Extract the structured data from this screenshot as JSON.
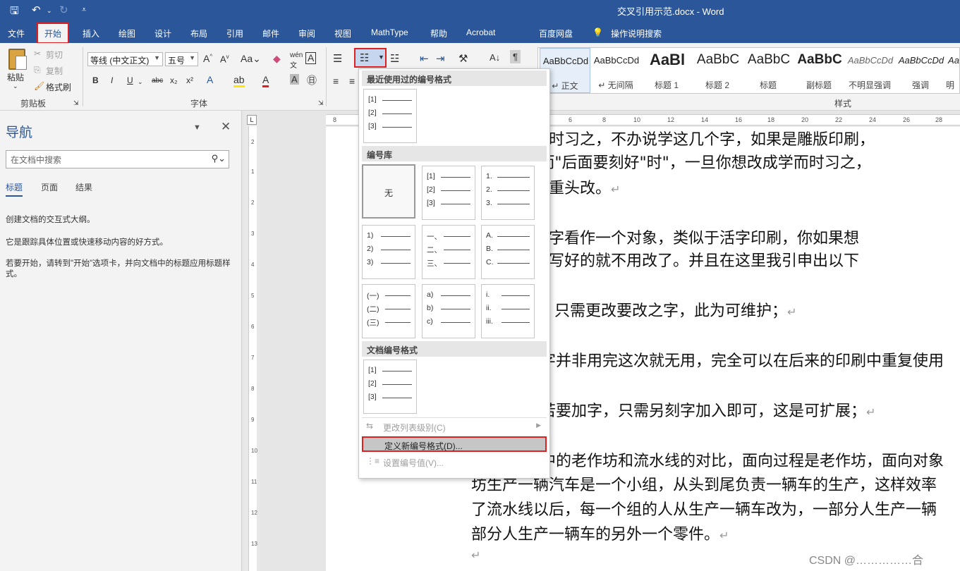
{
  "titlebar": {
    "document_title": "交叉引用示范.docx  -  Word",
    "icons": [
      "save-icon",
      "undo-icon",
      "redo-icon",
      "customize-icon"
    ]
  },
  "tabs": [
    "文件",
    "开始",
    "插入",
    "绘图",
    "设计",
    "布局",
    "引用",
    "邮件",
    "审阅",
    "视图",
    "MathType",
    "帮助",
    "Acrobat",
    "百度网盘",
    "操作说明搜索"
  ],
  "ribbon": {
    "clipboard": {
      "paste": "粘贴",
      "cut": "剪切",
      "copy": "复制",
      "format_painter": "格式刷",
      "group_label": "剪贴板"
    },
    "font": {
      "font_name": "等线 (中文正文)",
      "font_size": "五号",
      "group_label": "字体",
      "buttons": [
        "B",
        "I",
        "U",
        "abc",
        "x₂",
        "x²"
      ]
    },
    "styles": {
      "group_label": "样式",
      "items": [
        {
          "preview": "AaBbCcDd",
          "name": "↵ 正文"
        },
        {
          "preview": "AaBbCcDd",
          "name": "↵ 无间隔"
        },
        {
          "preview": "AaBl",
          "name": "标题 1"
        },
        {
          "preview": "AaBbC",
          "name": "标题 2"
        },
        {
          "preview": "AaBbC",
          "name": "标题"
        },
        {
          "preview": "AaBbC",
          "name": "副标题"
        },
        {
          "preview": "AaBbCcDd",
          "name": "不明显强调"
        },
        {
          "preview": "AaBbCcDd",
          "name": "强调"
        },
        {
          "preview": "Aa",
          "name": "明"
        }
      ]
    }
  },
  "navigation": {
    "title": "导航",
    "search_placeholder": "在文档中搜索",
    "tabs": [
      "标题",
      "页面",
      "结果"
    ],
    "info": [
      "创建文档的交互式大纲。",
      "它是跟踪具体位置或快速移动内容的好方式。",
      "若要开始，请转到\"开始\"选项卡，并向文档中的标题应用标题样式。"
    ]
  },
  "numbering_menu": {
    "recent_header": "最近使用过的编号格式",
    "library_header": "编号库",
    "document_header": "文档编号格式",
    "none_label": "无",
    "recent_formats": [
      [
        "[1]",
        "[2]",
        "[3]"
      ]
    ],
    "library_formats": [
      [
        "[1]",
        "[2]",
        "[3]"
      ],
      [
        "1.",
        "2.",
        "3."
      ],
      [
        "1)",
        "2)",
        "3)"
      ],
      [
        "一、",
        "二、",
        "三、"
      ],
      [
        "A.",
        "B.",
        "C."
      ],
      [
        "(一)",
        "(二)",
        "(三)"
      ],
      [
        "a)",
        "b)",
        "c)"
      ],
      [
        "i.",
        "ii.",
        "iii."
      ]
    ],
    "document_formats": [
      [
        "[1]",
        "[2]",
        "[3]"
      ]
    ],
    "change_level": "更改列表级别(C)",
    "define_new": "定义新编号格式(D)...",
    "set_value": "设置编号值(V)..."
  },
  "document": {
    "lines": [
      "要刻下学而时习之，不办说学这几个字，如果是雕版印刷，",
      "刻\"而\"，\"而\"后面要刻好\"时\"，一旦你想改成学而时习之，",
      "就得作废，重头改。",
      "则把每一个字看作一个对象，类似于活字印刷，你如果想",
      "以了，其它写好的就不用改了。并且在这里我引申出以下",
      "只需更改要改之字，此为可维护；",
      "字并非用完这次就无用，完全可以在后来的印刷中重复使用",
      "若要加字，只需另刻字加入即可，这是可扩展；",
      "中的老作坊和流水线的对比，面向过程是老作坊，面向对象",
      "坊生产一辆汽车是一个小组，从头到尾负责一辆车的生产，这样效率",
      "了流水线以后，每一个组的人从生产一辆车改为，一部分人生产一辆",
      "部分人生产一辆车的另外一个零件。"
    ],
    "paragraph_mark": "↵"
  },
  "watermark": "CSDN @……………合"
}
